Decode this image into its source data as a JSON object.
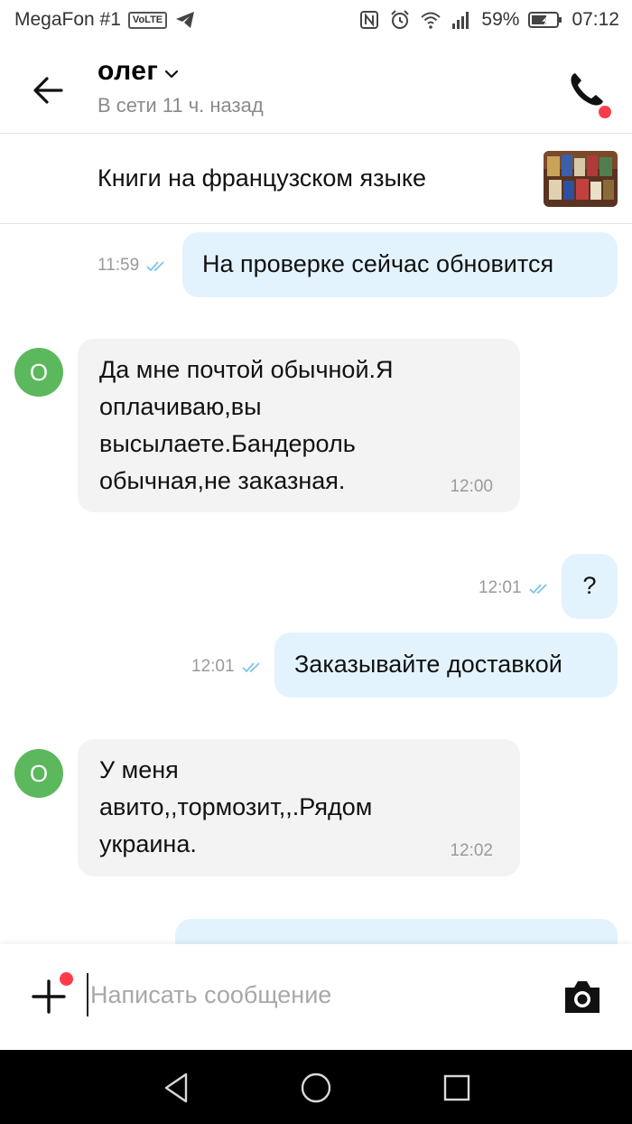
{
  "status_bar": {
    "carrier": "MegaFon #1",
    "volte": "VoLTE",
    "battery": "59%",
    "time": "07:12"
  },
  "header": {
    "contact_name": "олег",
    "contact_status": "В сети 11 ч. назад"
  },
  "item": {
    "title": "Книги на французском языке"
  },
  "messages": [
    {
      "direction": "out",
      "text": "На проверке сейчас обновится",
      "time": "11:59"
    },
    {
      "direction": "in",
      "avatar": "О",
      "lines": [
        "Да мне почтой обычной.Я",
        "оплачиваю,вы",
        "высылаете.Бандероль",
        "обычная,не заказная."
      ],
      "time": "12:00"
    },
    {
      "direction": "out",
      "text": "?",
      "time": "12:01"
    },
    {
      "direction": "out",
      "text": "Заказывайте доставкой",
      "time": "12:01"
    },
    {
      "direction": "in",
      "avatar": "О",
      "lines": [
        "У меня",
        "авито,,тормозит,,.Рядом",
        "украина."
      ],
      "time": "12:02"
    }
  ],
  "composer": {
    "placeholder": "Написать сообщение"
  },
  "colors": {
    "outgoing_bubble": "#e3f3fd",
    "incoming_bubble": "#f3f3f3",
    "avatar": "#5cb85c",
    "notification_dot": "#ff3b4a",
    "read_checks": "#7cc4ea"
  }
}
